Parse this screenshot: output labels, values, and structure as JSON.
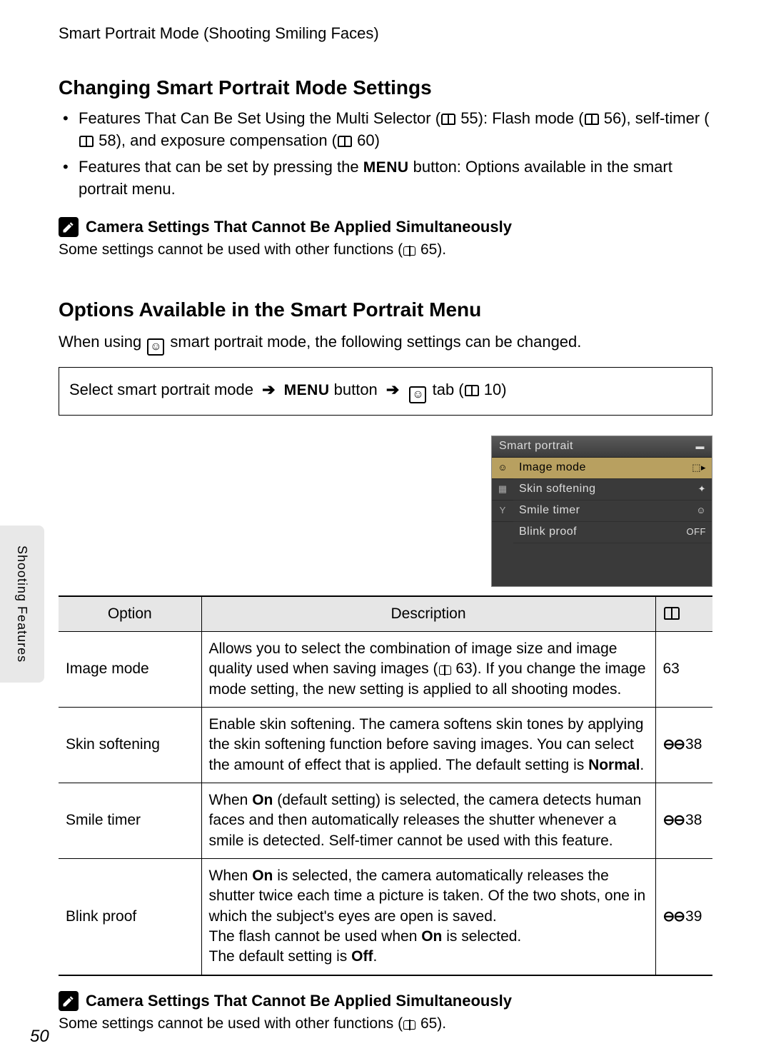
{
  "runningHead": "Smart Portrait Mode (Shooting Smiling Faces)",
  "sidebar": {
    "label": "Shooting Features"
  },
  "pageNumber": "50",
  "section1": {
    "heading": "Changing Smart Portrait Mode Settings",
    "bullet1a": "Features That Can Be Set Using the Multi Selector (",
    "bullet1b": "55): Flash mode (",
    "bullet1c": "56), self-timer (",
    "bullet1d": "58), and exposure compensation (",
    "bullet1e": "60)",
    "bullet2a": "Features that can be set by pressing the ",
    "bullet2menu": "MENU",
    "bullet2b": " button: Options available in the smart portrait menu."
  },
  "note": {
    "heading": "Camera Settings That Cannot Be Applied Simultaneously",
    "body_a": "Some settings cannot be used with other functions (",
    "body_b": "65)."
  },
  "section2": {
    "heading": "Options Available in the Smart Portrait Menu",
    "intro_a": "When using ",
    "intro_b": " smart portrait mode, the following settings can be changed."
  },
  "nav": {
    "part1": "Select smart portrait mode",
    "part2": "MENU",
    "part3": " button",
    "part4": " tab (",
    "part5": "10)"
  },
  "lcd": {
    "title": "Smart portrait",
    "items": [
      {
        "label": "Image mode",
        "value": ""
      },
      {
        "label": "Skin softening",
        "value": ""
      },
      {
        "label": "Smile timer",
        "value": ""
      },
      {
        "label": "Blink proof",
        "value": "OFF"
      }
    ]
  },
  "table": {
    "headers": {
      "option": "Option",
      "description": "Description"
    },
    "rows": [
      {
        "option": "Image mode",
        "desc_a": "Allows you to select the combination of image size and image quality used when saving images (",
        "desc_b": "63). If you change the image mode setting, the new setting is applied to all shooting modes.",
        "ref": "63",
        "refType": "plain"
      },
      {
        "option": "Skin softening",
        "desc_a": "Enable skin softening. The camera softens skin tones by applying the skin softening function before saving images. You can select the amount of effect that is applied. The default setting is ",
        "bold1": "Normal",
        "desc_b": ".",
        "ref": "38",
        "refType": "icon"
      },
      {
        "option": "Smile timer",
        "desc_a": "When ",
        "bold1": "On",
        "desc_b": " (default setting) is selected, the camera detects human faces and then automatically releases the shutter whenever a smile is detected. Self-timer cannot be used with this feature.",
        "ref": "38",
        "refType": "icon"
      },
      {
        "option": "Blink proof",
        "desc_a": "When ",
        "bold1": "On",
        "desc_b": " is selected, the camera automatically releases the shutter twice each time a picture is taken. Of the two shots, one in which the subject's eyes are open is saved.",
        "line2a": "The flash cannot be used when ",
        "bold2": "On",
        "line2b": " is selected.",
        "line3a": "The default setting is ",
        "bold3": "Off",
        "line3b": ".",
        "ref": "39",
        "refType": "icon"
      }
    ]
  }
}
